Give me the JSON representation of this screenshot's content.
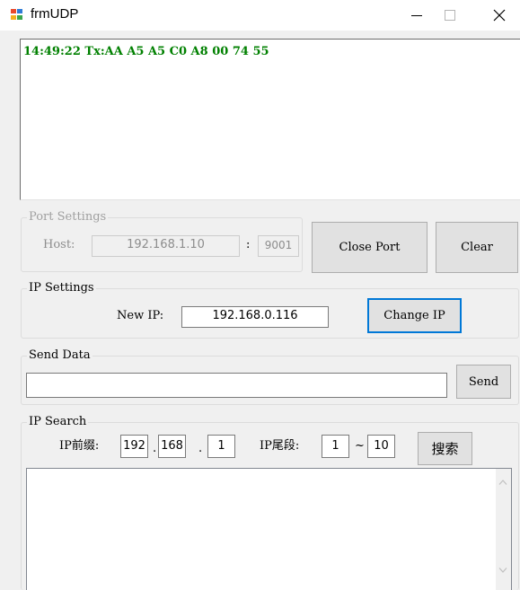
{
  "window": {
    "title": "frmUDP"
  },
  "output": {
    "lines": [
      "14:49:22 Tx:AA A5 A5 C0 A8 00 74 55"
    ],
    "text_color": "#008000"
  },
  "port_settings": {
    "title": "Port Settings",
    "host_label": "Host:",
    "host_value": "192.168.1.10",
    "port_separator": ":",
    "port_value": "9001",
    "close_port_label": "Close Port",
    "clear_label": "Clear"
  },
  "ip_settings": {
    "title": "IP Settings",
    "new_ip_label": "New IP:",
    "new_ip_value": "192.168.0.116",
    "change_ip_label": "Change IP"
  },
  "send_data": {
    "title": "Send Data",
    "value": "",
    "send_label": "Send"
  },
  "ip_search": {
    "title": "IP Search",
    "prefix_label": "IP前缀:",
    "prefix_octets": [
      "192",
      "168",
      "1"
    ],
    "dot": ".",
    "suffix_label": "IP尾段:",
    "range_start": "1",
    "range_sep": "~",
    "range_end": "10",
    "search_label": "搜索"
  },
  "icons": {
    "app": "window-app-icon",
    "minimize": "minimize-icon",
    "maximize": "maximize-icon",
    "close": "close-icon",
    "scroll_up": "chevron-up-icon",
    "scroll_down": "chevron-down-icon"
  },
  "colors": {
    "accent_focus": "#0078d7",
    "window_bg": "#f0f0f0"
  }
}
